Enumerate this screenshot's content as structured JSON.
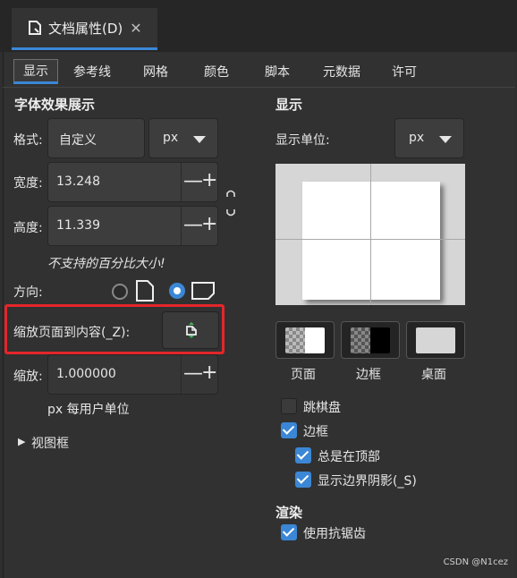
{
  "window": {
    "tab_title": "文档属性(D)",
    "close_glyph": "✕"
  },
  "tabs": [
    "显示",
    "参考线",
    "网格",
    "颜色",
    "脚本",
    "元数据",
    "许可"
  ],
  "left": {
    "section_title": "字体效果展示",
    "format_label": "格式:",
    "format_value": "自定义",
    "format_unit": "px",
    "width_label": "宽度:",
    "width_value": "13.248",
    "height_label": "高度:",
    "height_value": "11.339",
    "minus": "—",
    "plus": "+",
    "note": "不支持的百分比大小!",
    "orientation_label": "方向:",
    "fit_label": "缩放页面到内容(_Z):",
    "scale_label": "缩放:",
    "scale_value": "1.000000",
    "per_user_unit": "px 每用户单位",
    "viewbox_label": "视图框",
    "expander_glyph": "▶"
  },
  "right": {
    "section_title": "显示",
    "display_unit_label": "显示单位:",
    "display_unit_value": "px",
    "swatches": {
      "page": "页面",
      "border": "边框",
      "desk": "桌面"
    },
    "checkerboard": "跳棋盘",
    "border_check": "边框",
    "always_on_top": "总是在顶部",
    "show_border_shadow": "显示边界阴影(_S)",
    "render_title": "渲染",
    "antialias": "使用抗锯齿"
  },
  "watermark": "CSDN @N1cez",
  "colors": {
    "accent": "#3b87d6",
    "highlight": "#e3262a"
  }
}
